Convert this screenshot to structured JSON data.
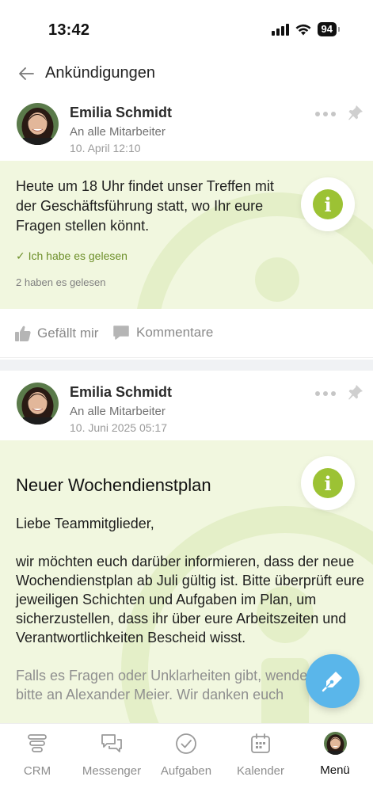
{
  "status": {
    "time": "13:42",
    "battery": "94"
  },
  "header": {
    "title": "Ankündigungen"
  },
  "posts": [
    {
      "author": "Emilia Schmidt",
      "audience": "An alle Mitarbeiter",
      "date": "10. April 12:10",
      "text": "Heute um 18 Uhr findet unser Treffen mit der Geschäftsführung statt, wo Ihr eure Fragen stellen könnt.",
      "read_confirm": "✓ Ich habe es gelesen",
      "read_count": "2 haben es gelesen",
      "like_label": "Gefällt mir",
      "comment_label": "Kommentare"
    },
    {
      "author": "Emilia Schmidt",
      "audience": "An alle Mitarbeiter",
      "date": "10. Juni 2025 05:17",
      "title": "Neuer Wochendienstplan",
      "greeting": "Liebe Teammitglieder,",
      "paragraph1": "wir möchten euch darüber informieren, dass der neue Wochendienstplan ab Juli gültig ist. Bitte überprüft eure jeweiligen Schichten und Aufgaben im Plan, um sicherzustellen, dass ihr über eure Arbeitszeiten und Verantwortlichkeiten Bescheid wisst.",
      "paragraph2": "Falls es Fragen oder Unklarheiten gibt, wendet euch bitte an Alexander Meier. Wir danken euch"
    }
  ],
  "tabbar": {
    "items": [
      {
        "label": "CRM",
        "icon": "crm-stack-icon"
      },
      {
        "label": "Messenger",
        "icon": "chat-bubbles-icon"
      },
      {
        "label": "Aufgaben",
        "icon": "check-circle-icon"
      },
      {
        "label": "Kalender",
        "icon": "calendar-icon"
      },
      {
        "label": "Menü",
        "icon": "avatar"
      }
    ],
    "active": "Menü"
  },
  "colors": {
    "accent_green": "#9cc234",
    "post_bg": "#f1f7df",
    "fab_blue": "#5ab6ea",
    "read_green": "#6d8f2a"
  },
  "icons": {
    "back": "arrow-left-icon",
    "more": "more-dots-icon",
    "pin": "pin-icon",
    "info": "info-icon",
    "like": "thumbs-up-icon",
    "comment": "comment-icon",
    "fab": "pen-icon"
  }
}
